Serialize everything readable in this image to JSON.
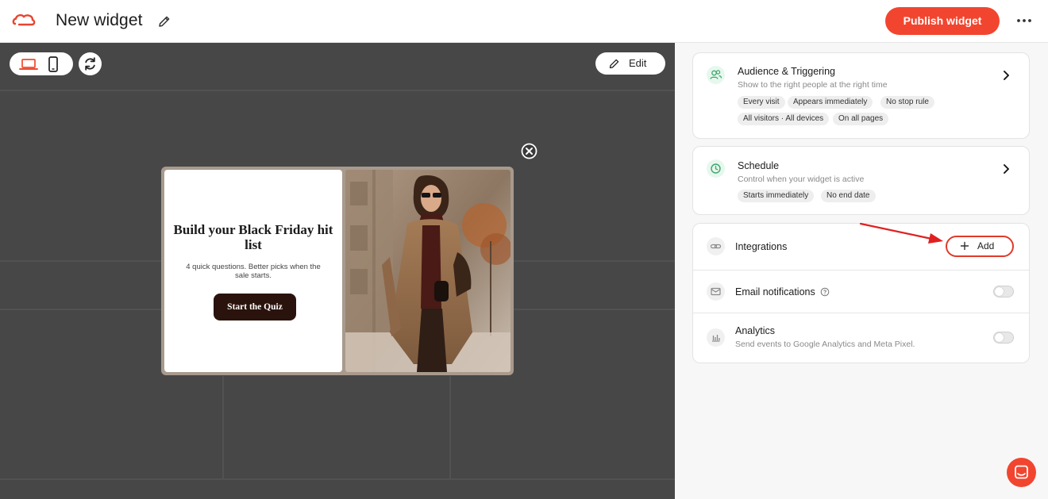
{
  "header": {
    "title": "New widget",
    "publish_label": "Publish widget",
    "brand_color": "#f2452f"
  },
  "canvas": {
    "edit_label": "Edit",
    "device_options": [
      "laptop-icon",
      "mobile-icon"
    ],
    "active_device": "laptop-icon",
    "background": "#474747"
  },
  "popup": {
    "heading": "Build your Black Friday hit list",
    "subtext": "4 quick questions. Better picks when the sale starts.",
    "cta_label": "Start the Quiz",
    "cta_color": "#2b130d"
  },
  "sidebar": {
    "audience": {
      "title": "Audience & Triggering",
      "description": "Show to the right people at the right time",
      "chips": [
        "Every visit",
        "Appears immediately",
        "No stop rule",
        "All visitors · All devices",
        "On all pages"
      ],
      "icon": "users-icon"
    },
    "schedule": {
      "title": "Schedule",
      "description": "Control when your widget is active",
      "chips": [
        "Starts immediately",
        "No end date"
      ],
      "icon": "clock-icon"
    },
    "integrations": {
      "title": "Integrations",
      "add_label": "Add",
      "icon": "link-icon"
    },
    "email_notifications": {
      "title": "Email notifications",
      "enabled": false,
      "icon": "mail-icon"
    },
    "analytics": {
      "title": "Analytics",
      "description": "Send events to Google Analytics and Meta Pixel.",
      "enabled": false,
      "icon": "bar-chart-icon"
    }
  },
  "annotation": {
    "arrow_color": "#e02020"
  }
}
